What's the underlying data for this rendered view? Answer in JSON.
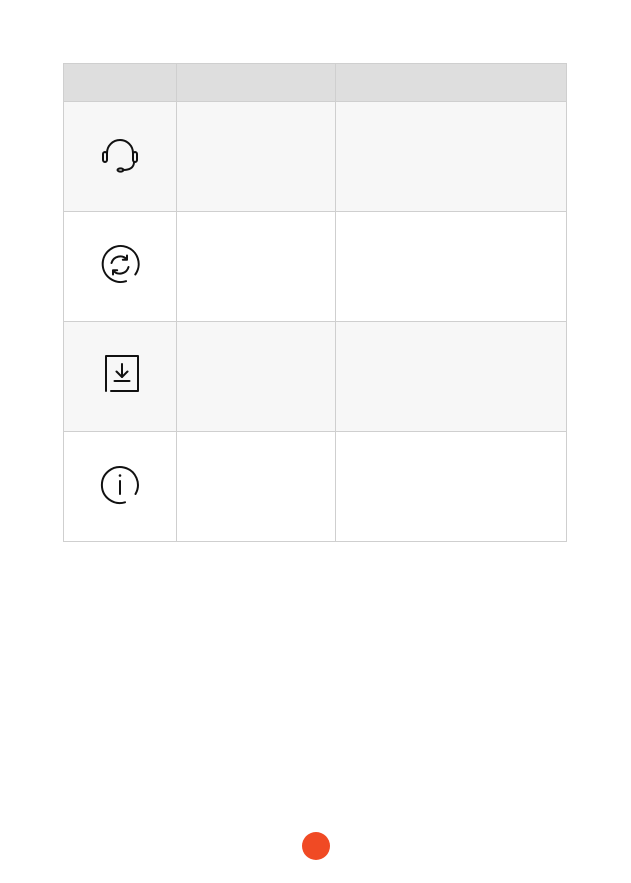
{
  "table": {
    "headers": [
      "",
      "",
      ""
    ],
    "rows": [
      {
        "icon": "headset-icon",
        "name": "",
        "description": ""
      },
      {
        "icon": "refresh-icon",
        "name": "",
        "description": ""
      },
      {
        "icon": "download-document-icon",
        "name": "",
        "description": ""
      },
      {
        "icon": "info-icon",
        "name": "",
        "description": ""
      }
    ]
  },
  "colors": {
    "header_bg": "#dedede",
    "shaded_row_bg": "#f7f7f7",
    "border": "#cfcfcf",
    "page_dot": "#f04a24"
  }
}
